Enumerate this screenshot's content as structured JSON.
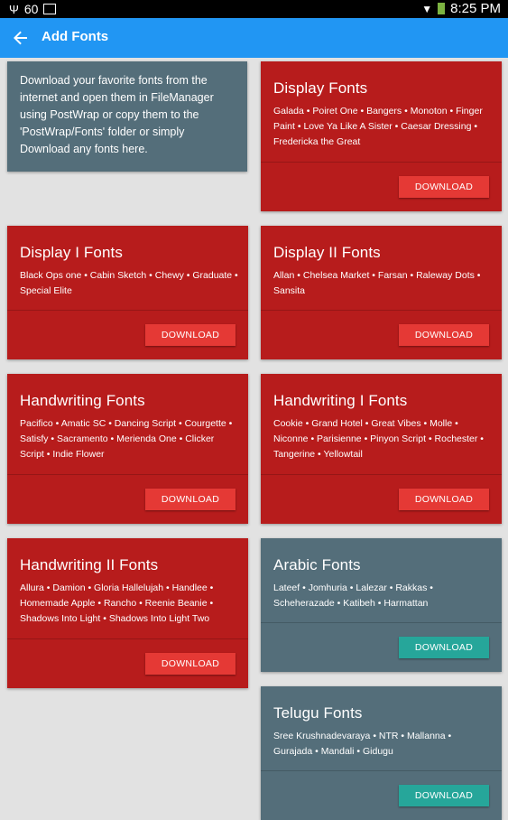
{
  "status_bar": {
    "battery_level": "60",
    "time": "8:25 PM"
  },
  "app_bar": {
    "title": "Add Fonts",
    "back_icon": "arrow-left-icon"
  },
  "intro": {
    "text_parts": [
      "Download your favorite fonts from the internet and open them in ",
      "FileManager",
      " using ",
      "PostWrap",
      " or copy them to the '",
      "PostWrap/Fonts'",
      " folder or simply ",
      "Download",
      " any fonts here."
    ]
  },
  "colors": {
    "app_bar": "#2196f3",
    "red_card": "#b71c1c",
    "slate_card": "#546e7a",
    "red_button": "#e53935",
    "teal_button": "#26a69a"
  },
  "cards": [
    {
      "title": "Display Fonts",
      "fonts": "Galada • Poiret One • Bangers • Monoton • Finger Paint • Love Ya Like A Sister • Caesar Dressing • Fredericka the Great",
      "button": "DOWNLOAD"
    },
    {
      "title": "Display I Fonts",
      "fonts": "Black Ops one • Cabin Sketch • Chewy • Graduate • Special Elite",
      "button": "DOWNLOAD"
    },
    {
      "title": "Display II Fonts",
      "fonts": "Allan • Chelsea Market • Farsan • Raleway Dots • Sansita",
      "button": "DOWNLOAD"
    },
    {
      "title": "Handwriting Fonts",
      "fonts": "Pacifico • Amatic SC • Dancing Script • Courgette • Satisfy • Sacramento • Merienda One • Clicker Script • Indie Flower",
      "button": "DOWNLOAD"
    },
    {
      "title": "Handwriting I Fonts",
      "fonts": "Cookie • Grand Hotel • Great Vibes • Molle • Niconne • Parisienne • Pinyon Script • Rochester • Tangerine • Yellowtail",
      "button": "DOWNLOAD"
    },
    {
      "title": "Handwriting II Fonts",
      "fonts": "Allura • Damion • Gloria Hallelujah • Handlee • Homemade Apple • Rancho • Reenie Beanie • Shadows Into Light • Shadows Into Light Two",
      "button": "DOWNLOAD"
    },
    {
      "title": "Arabic Fonts",
      "fonts": "Lateef • Jomhuria • Lalezar • Rakkas • Scheherazade • Katibeh • Harmattan",
      "button": "DOWNLOAD"
    },
    {
      "title": "Telugu Fonts",
      "fonts": "Sree Krushnadevaraya • NTR • Mallanna • Gurajada • Mandali • Gidugu",
      "button": "DOWNLOAD"
    }
  ]
}
